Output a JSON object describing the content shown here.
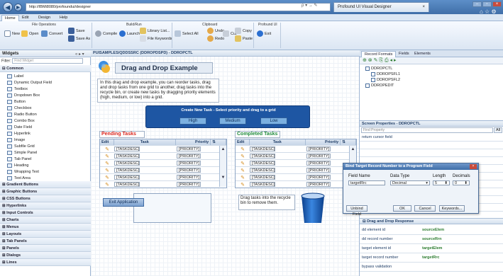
{
  "browser": {
    "url": "http://IBMi8080/profoundui/designer",
    "tab_title": "Profound UI Visual Designer",
    "tab_close": "×",
    "address_icons": "ρ ▾ → ✎"
  },
  "ribbon": {
    "tabs": [
      "Home",
      "Edit",
      "Design",
      "Help"
    ],
    "groups": {
      "file": "File Operations",
      "build": "Build/Run",
      "clipboard": "Clipboard",
      "profound": "Profound UI"
    },
    "buttons": {
      "new": "New",
      "open": "Open",
      "convert": "Convert",
      "save": "Save",
      "save_as": "Save As",
      "compile": "Compile",
      "launch": "Launch",
      "library_list": "Library List...",
      "file_keywords": "File Keywords",
      "select_all": "Select All",
      "undo": "Undo",
      "redo": "Redo",
      "cut": "Cut",
      "copy": "Copy",
      "paste": "Paste",
      "exit": "Exit"
    }
  },
  "widgets_panel": {
    "title": "Widgets",
    "filter_label": "Filter:",
    "filter_placeholder": "Find Widget",
    "common_label": "Common",
    "common_items": [
      "Label",
      "Dynamic Output Field",
      "Textbox",
      "Dropdown Box",
      "Button",
      "Checkbox",
      "Radio Button",
      "Combo Box",
      "Date Field",
      "Hyperlink",
      "Image",
      "Subfile Grid",
      "Simple Panel",
      "Tab Panel",
      "Heading",
      "Wrapping Text",
      "Text Area"
    ],
    "categories": [
      "Gradient Buttons",
      "Graphic Buttons",
      "CSS Buttons",
      "Hyperlinks",
      "Input Controls",
      "Charts",
      "Menus",
      "Layouts",
      "Tab Panels",
      "Panels",
      "Dialogs",
      "Lines"
    ]
  },
  "canvas": {
    "header": "PUISAMPLES/QDDSSRC (DDROPDSPD) - DDROPCTL",
    "heading": "Drag and Drop Example",
    "intro": "In this drag and drop example, you can reorder tasks, drag and drop tasks from one grid to another, drag tasks into the recycle bin, or create new tasks by dragging priority elements (high, medium, or low) into a grid.",
    "create_title": "Create New Task - Select priority and drag to a grid",
    "priorities": [
      "High",
      "Medium",
      "Low"
    ],
    "pending_title": "Pending Tasks",
    "completed_title": "Completed Tasks",
    "grid_headers": {
      "edit": "Edit",
      "task": "Task",
      "priority": "Priority"
    },
    "task_placeholder": "[TASKDESC]",
    "priority_placeholder": "[PRIORITY]",
    "exit_button": "Exit Application",
    "recycle_text": "Drag tasks into the recycle bin to remove them."
  },
  "right_panel": {
    "tabs": [
      "Record Formats",
      "Fields",
      "Elements"
    ],
    "tree": [
      "DDROPCTL",
      "DDROPSFL1",
      "DDROPSFL2",
      "DDROPEDIT"
    ],
    "screen_props_title": "Screen Properties - DDROPCTL",
    "find_property_placeholder": "Find Property",
    "all_button": "All",
    "prop_rows": [
      "return cursor field"
    ],
    "drag_drop_title": "Drag and Drop Response",
    "dd_rows": [
      {
        "name": "dd element id",
        "value": "sourceElem"
      },
      {
        "name": "dd record number",
        "value": "sourceRrn"
      },
      {
        "name": "target element id",
        "value": "targetElem"
      },
      {
        "name": "target record number",
        "value": "targetRrc"
      },
      {
        "name": "bypass validation",
        "value": ""
      }
    ]
  },
  "dialog": {
    "title": "Bind Target Record Number to a Program Field",
    "field_name_label": "Field Name",
    "data_type_label": "Data Type",
    "length_label": "Length",
    "decimals_label": "Decimals",
    "field_name_value": "targetRrc",
    "data_type_value": "Decimal",
    "length_value": "5",
    "decimals_value": "0",
    "unbind_button": "Unbind Field",
    "ok_button": "OK",
    "cancel_button": "Cancel",
    "keywords_button": "Keywords..."
  },
  "colors": {
    "accent": "#1e56a3",
    "link_green": "#2e7d32",
    "pending_red": "#d9251c"
  }
}
